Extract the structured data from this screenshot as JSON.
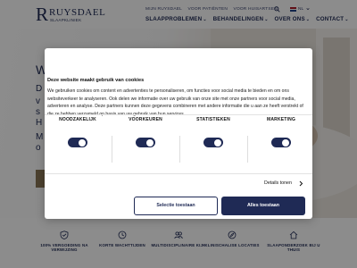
{
  "header": {
    "logo": {
      "name": "RUYSDAEL",
      "subtitle": "SLAAPKLINIEK"
    },
    "top_links": [
      "MIJN RUYSDAEL",
      "VOOR PATIËNTEN",
      "VOOR HUISARTSEN"
    ],
    "language": "NL",
    "main_nav": [
      {
        "label": "SLAAPPROBLEMEN",
        "chevron": "⌄"
      },
      {
        "label": "BEHANDELINGEN",
        "chevron": "⌄"
      },
      {
        "label": "OVER ONS",
        "chevron": "⌄"
      },
      {
        "label": "CONTACT",
        "chevron": "⌄"
      }
    ]
  },
  "hero": {
    "fragments": [
      "W",
      "D",
      "v",
      "s",
      "H",
      "M",
      "o"
    ]
  },
  "features": [
    {
      "icon": "shield-check-icon",
      "label": "100% VERGOEDING NA VERWIJZING"
    },
    {
      "icon": "clock-icon",
      "label": "KORTE WACHTTIJDEN"
    },
    {
      "icon": "people-icon",
      "label": "MULTIDISCIPLINAIRE KIJK"
    },
    {
      "icon": "compass-icon",
      "label": "KLINISCHALISE LOCATIES"
    },
    {
      "icon": "home-icon",
      "label": "SLAAPONDERZOEK BIJ U THUIS"
    }
  ],
  "cookie": {
    "title": "Deze website maakt gebruik van cookies",
    "text": "We gebruiken cookies om content en advertenties te personaliseren, om functies voor social media te bieden en om ons websiteverkeer te analyseren. Ook delen we informatie over uw gebruik van onze site met onze partners voor social media, adverteren en analyse. Deze partners kunnen deze gegevens combineren met andere informatie die u aan ze heeft verstrekt of die ze hebben verzameld op basis van uw gebruik van hun services.",
    "categories": [
      {
        "label": "NOODZAKELIJK",
        "enabled": true
      },
      {
        "label": "VOORKEUREN",
        "enabled": true
      },
      {
        "label": "STATISTIEKEN",
        "enabled": true
      },
      {
        "label": "MARKETING",
        "enabled": true
      }
    ],
    "details_label": "Details tonen",
    "details_chevron": "›",
    "select_button": "Selectie toestaan",
    "allow_all_button": "Alles toestaan"
  },
  "colors": {
    "brand_navy": "#1f2a55",
    "gold": "#8a7757",
    "overlay": "rgba(0,0,0,0.45)"
  }
}
